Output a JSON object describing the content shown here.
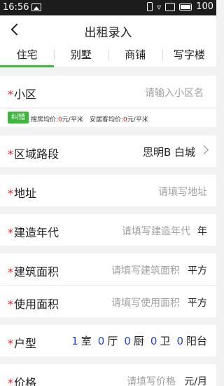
{
  "status": {
    "time": "16:56",
    "battery": "100"
  },
  "header": {
    "title": "出租录入"
  },
  "tabs": [
    "住宅",
    "别墅",
    "商铺",
    "写字楼"
  ],
  "active_tab": 0,
  "colors": {
    "accent": "#3cb63c",
    "required": "#e02020",
    "number": "#2747c9"
  },
  "form": {
    "community": {
      "label": "小区",
      "placeholder": "请输入小区名"
    },
    "price_info": {
      "tag": "纠错",
      "sale_avg_label": "搜房均价:",
      "sale_avg_value": "0",
      "sale_avg_unit": "元/平米",
      "anju_avg_label": "安居客均价:",
      "anju_avg_value": "0",
      "anju_avg_unit": "元/平米"
    },
    "region": {
      "label": "区域路段",
      "value": "思明B 白城"
    },
    "address": {
      "label": "地址",
      "placeholder": "请填写地址"
    },
    "year": {
      "label": "建造年代",
      "placeholder": "请填写建造年代",
      "unit": "年"
    },
    "build_area": {
      "label": "建筑面积",
      "placeholder": "请填写建筑面积",
      "unit": "平方"
    },
    "use_area": {
      "label": "使用面积",
      "placeholder": "请填写使用面积",
      "unit": "平方"
    },
    "layout": {
      "label": "户型",
      "room": "1",
      "room_unit": "室",
      "hall": "0",
      "hall_unit": "厅",
      "kitchen": "0",
      "kitchen_unit": "厨",
      "bath": "0",
      "bath_unit": "卫",
      "balcony": "0",
      "balcony_unit": "阳台"
    },
    "price": {
      "label": "价格",
      "placeholder": "请填写价格",
      "unit": "元/月"
    }
  }
}
